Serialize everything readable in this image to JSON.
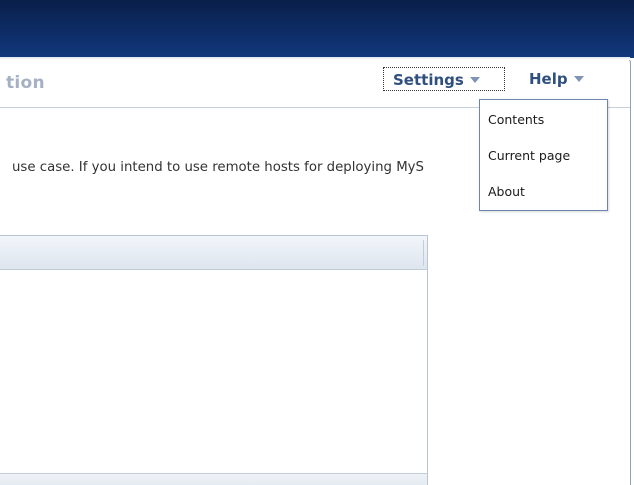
{
  "header": {
    "page_title": "tion",
    "settings_label": "Settings",
    "help_label": "Help"
  },
  "content": {
    "description": "use case. If you intend to use remote hosts for deploying MyS"
  },
  "help_menu": {
    "items": [
      {
        "label": "Contents"
      },
      {
        "label": "Current page"
      },
      {
        "label": "About"
      }
    ]
  },
  "icons": {
    "settings_caret": "chevron-down-icon",
    "help_caret": "chevron-down-icon"
  },
  "colors": {
    "banner": "#0d2c66",
    "menu_text": "#2f4f7f",
    "title_text": "#a4b1c4",
    "dropdown_border": "#6d84ac"
  }
}
